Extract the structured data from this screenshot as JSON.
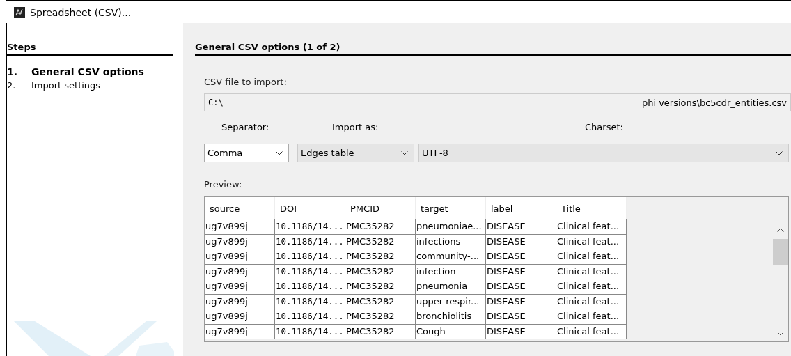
{
  "window": {
    "title": "Spreadsheet (CSV)..."
  },
  "steps": {
    "title": "Steps",
    "items": [
      {
        "number": "1.",
        "label": "General CSV options",
        "selected": true
      },
      {
        "number": "2.",
        "label": "Import settings",
        "selected": false
      }
    ]
  },
  "page": {
    "title": "General CSV options (1 of 2)",
    "file_label": "CSV file to import:",
    "file_path_start": "C:\\",
    "file_path_end": "phi versions\\bc5cdr_entities.csv",
    "separator": {
      "label": "Separator:",
      "value": "Comma"
    },
    "import_as": {
      "label": "Import as:",
      "value": "Edges table"
    },
    "charset": {
      "label": "Charset:",
      "value": "UTF-8"
    }
  },
  "preview": {
    "label": "Preview:",
    "columns": [
      "source",
      "DOI",
      "PMCID",
      "target",
      "label",
      "Title"
    ],
    "rows": [
      [
        "ug7v899j",
        "10.1186/14...",
        "PMC35282",
        "pneumoniae...",
        "DISEASE",
        "Clinical feat..."
      ],
      [
        "ug7v899j",
        "10.1186/14...",
        "PMC35282",
        "infections",
        "DISEASE",
        "Clinical feat..."
      ],
      [
        "ug7v899j",
        "10.1186/14...",
        "PMC35282",
        "community-...",
        "DISEASE",
        "Clinical feat..."
      ],
      [
        "ug7v899j",
        "10.1186/14...",
        "PMC35282",
        "infection",
        "DISEASE",
        "Clinical feat..."
      ],
      [
        "ug7v899j",
        "10.1186/14...",
        "PMC35282",
        "pneumonia",
        "DISEASE",
        "Clinical feat..."
      ],
      [
        "ug7v899j",
        "10.1186/14...",
        "PMC35282",
        "upper respir...",
        "DISEASE",
        "Clinical feat..."
      ],
      [
        "ug7v899j",
        "10.1186/14...",
        "PMC35282",
        "bronchiolitis",
        "DISEASE",
        "Clinical feat..."
      ],
      [
        "ug7v899j",
        "10.1186/14...",
        "PMC35282",
        "Cough",
        "DISEASE",
        "Clinical feat..."
      ]
    ]
  }
}
